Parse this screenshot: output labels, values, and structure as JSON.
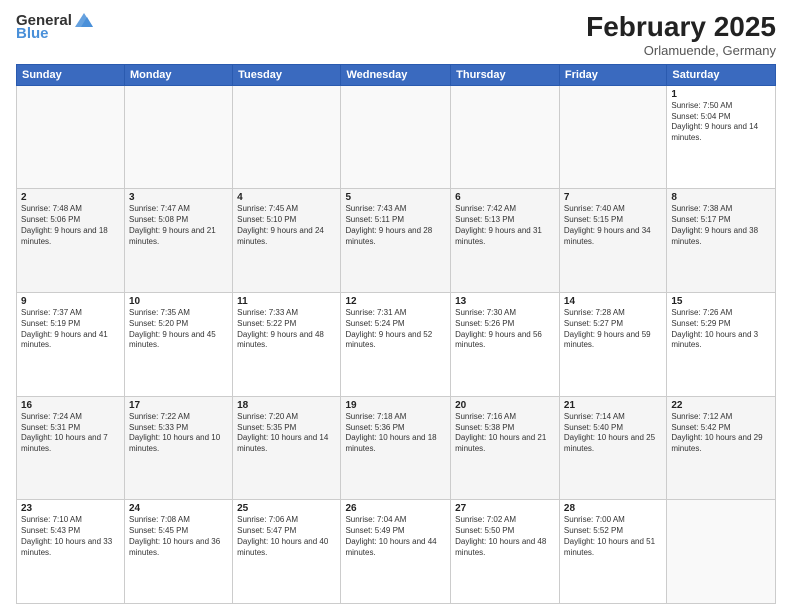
{
  "header": {
    "logo_general": "General",
    "logo_blue": "Blue",
    "title": "February 2025",
    "location": "Orlamuende, Germany"
  },
  "calendar": {
    "days_of_week": [
      "Sunday",
      "Monday",
      "Tuesday",
      "Wednesday",
      "Thursday",
      "Friday",
      "Saturday"
    ],
    "weeks": [
      [
        {
          "day": "",
          "info": ""
        },
        {
          "day": "",
          "info": ""
        },
        {
          "day": "",
          "info": ""
        },
        {
          "day": "",
          "info": ""
        },
        {
          "day": "",
          "info": ""
        },
        {
          "day": "",
          "info": ""
        },
        {
          "day": "1",
          "info": "Sunrise: 7:50 AM\nSunset: 5:04 PM\nDaylight: 9 hours and 14 minutes."
        }
      ],
      [
        {
          "day": "2",
          "info": "Sunrise: 7:48 AM\nSunset: 5:06 PM\nDaylight: 9 hours and 18 minutes."
        },
        {
          "day": "3",
          "info": "Sunrise: 7:47 AM\nSunset: 5:08 PM\nDaylight: 9 hours and 21 minutes."
        },
        {
          "day": "4",
          "info": "Sunrise: 7:45 AM\nSunset: 5:10 PM\nDaylight: 9 hours and 24 minutes."
        },
        {
          "day": "5",
          "info": "Sunrise: 7:43 AM\nSunset: 5:11 PM\nDaylight: 9 hours and 28 minutes."
        },
        {
          "day": "6",
          "info": "Sunrise: 7:42 AM\nSunset: 5:13 PM\nDaylight: 9 hours and 31 minutes."
        },
        {
          "day": "7",
          "info": "Sunrise: 7:40 AM\nSunset: 5:15 PM\nDaylight: 9 hours and 34 minutes."
        },
        {
          "day": "8",
          "info": "Sunrise: 7:38 AM\nSunset: 5:17 PM\nDaylight: 9 hours and 38 minutes."
        }
      ],
      [
        {
          "day": "9",
          "info": "Sunrise: 7:37 AM\nSunset: 5:19 PM\nDaylight: 9 hours and 41 minutes."
        },
        {
          "day": "10",
          "info": "Sunrise: 7:35 AM\nSunset: 5:20 PM\nDaylight: 9 hours and 45 minutes."
        },
        {
          "day": "11",
          "info": "Sunrise: 7:33 AM\nSunset: 5:22 PM\nDaylight: 9 hours and 48 minutes."
        },
        {
          "day": "12",
          "info": "Sunrise: 7:31 AM\nSunset: 5:24 PM\nDaylight: 9 hours and 52 minutes."
        },
        {
          "day": "13",
          "info": "Sunrise: 7:30 AM\nSunset: 5:26 PM\nDaylight: 9 hours and 56 minutes."
        },
        {
          "day": "14",
          "info": "Sunrise: 7:28 AM\nSunset: 5:27 PM\nDaylight: 9 hours and 59 minutes."
        },
        {
          "day": "15",
          "info": "Sunrise: 7:26 AM\nSunset: 5:29 PM\nDaylight: 10 hours and 3 minutes."
        }
      ],
      [
        {
          "day": "16",
          "info": "Sunrise: 7:24 AM\nSunset: 5:31 PM\nDaylight: 10 hours and 7 minutes."
        },
        {
          "day": "17",
          "info": "Sunrise: 7:22 AM\nSunset: 5:33 PM\nDaylight: 10 hours and 10 minutes."
        },
        {
          "day": "18",
          "info": "Sunrise: 7:20 AM\nSunset: 5:35 PM\nDaylight: 10 hours and 14 minutes."
        },
        {
          "day": "19",
          "info": "Sunrise: 7:18 AM\nSunset: 5:36 PM\nDaylight: 10 hours and 18 minutes."
        },
        {
          "day": "20",
          "info": "Sunrise: 7:16 AM\nSunset: 5:38 PM\nDaylight: 10 hours and 21 minutes."
        },
        {
          "day": "21",
          "info": "Sunrise: 7:14 AM\nSunset: 5:40 PM\nDaylight: 10 hours and 25 minutes."
        },
        {
          "day": "22",
          "info": "Sunrise: 7:12 AM\nSunset: 5:42 PM\nDaylight: 10 hours and 29 minutes."
        }
      ],
      [
        {
          "day": "23",
          "info": "Sunrise: 7:10 AM\nSunset: 5:43 PM\nDaylight: 10 hours and 33 minutes."
        },
        {
          "day": "24",
          "info": "Sunrise: 7:08 AM\nSunset: 5:45 PM\nDaylight: 10 hours and 36 minutes."
        },
        {
          "day": "25",
          "info": "Sunrise: 7:06 AM\nSunset: 5:47 PM\nDaylight: 10 hours and 40 minutes."
        },
        {
          "day": "26",
          "info": "Sunrise: 7:04 AM\nSunset: 5:49 PM\nDaylight: 10 hours and 44 minutes."
        },
        {
          "day": "27",
          "info": "Sunrise: 7:02 AM\nSunset: 5:50 PM\nDaylight: 10 hours and 48 minutes."
        },
        {
          "day": "28",
          "info": "Sunrise: 7:00 AM\nSunset: 5:52 PM\nDaylight: 10 hours and 51 minutes."
        },
        {
          "day": "",
          "info": ""
        }
      ]
    ]
  }
}
